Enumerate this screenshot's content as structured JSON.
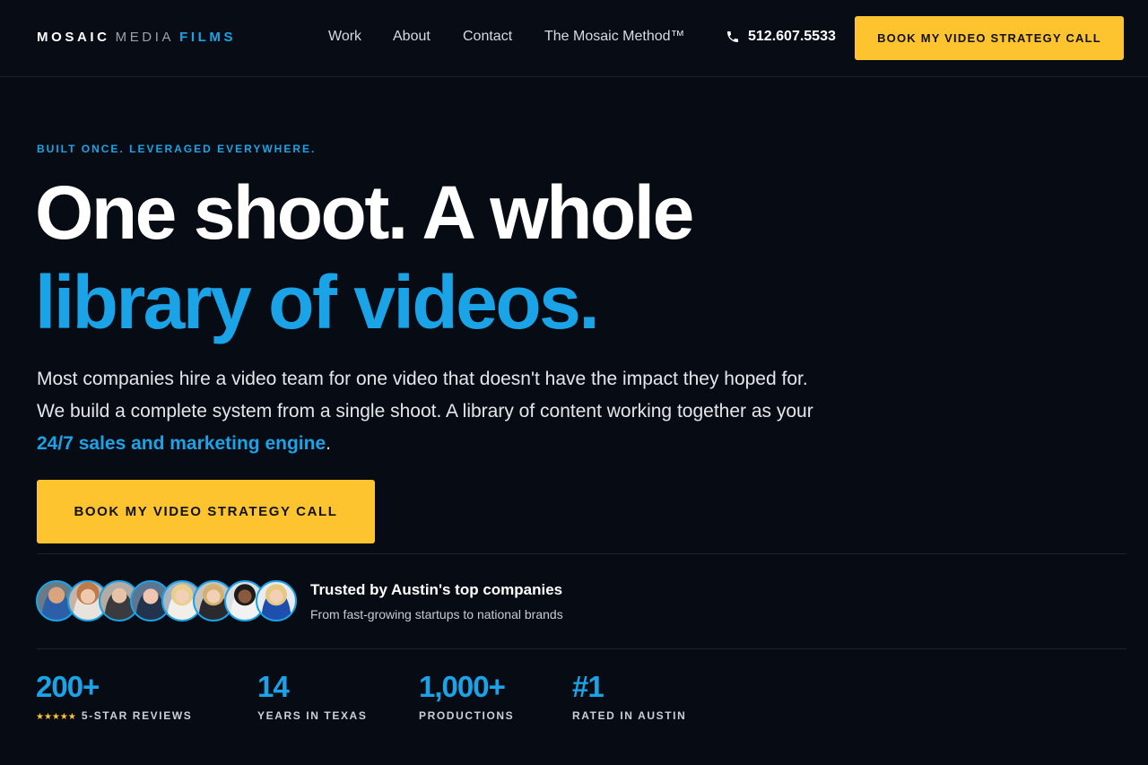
{
  "header": {
    "logo": {
      "word1": "MOSAIC",
      "word2": "MEDIA",
      "word3": "FILMS"
    },
    "nav": [
      {
        "label": "Work"
      },
      {
        "label": "About"
      },
      {
        "label": "Contact"
      },
      {
        "label": "The Mosaic Method™"
      }
    ],
    "phone": {
      "icon": "phone-icon",
      "number": "512.607.5533"
    },
    "cta_label": "BOOK MY VIDEO STRATEGY CALL"
  },
  "hero": {
    "eyebrow": "BUILT ONCE. LEVERAGED EVERYWHERE.",
    "headline_line1": "One shoot. A whole",
    "headline_line2": "library of videos.",
    "lead_text": "Most companies hire a video team for one video that doesn't have the impact they hoped for. We build a complete system from a single shoot. A library of content working together as your ",
    "lead_highlight": "24/7 sales and marketing engine",
    "lead_end": ".",
    "cta_label": "BOOK MY VIDEO STRATEGY CALL"
  },
  "trust": {
    "title": "Trusted by Austin's top companies",
    "subtitle": "From fast-growing startups to national brands"
  },
  "stats": [
    {
      "value": "200+",
      "label": "5-STAR REVIEWS",
      "stars": "★★★★★"
    },
    {
      "value": "14",
      "label": "YEARS IN TEXAS"
    },
    {
      "value": "1,000+",
      "label": "PRODUCTIONS"
    },
    {
      "value": "#1",
      "label": "RATED IN AUSTIN"
    }
  ],
  "colors": {
    "background": "#070c14",
    "accent_blue": "#1aa3e6",
    "accent_yellow": "#fdc430"
  }
}
